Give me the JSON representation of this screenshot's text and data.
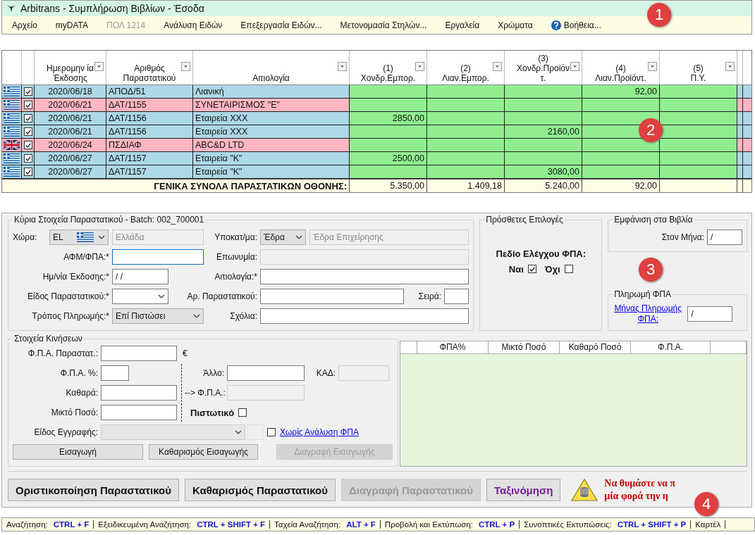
{
  "window": {
    "title": "Arbitrans - Συμπλήρωση Βιβλίων - Έσοδα"
  },
  "menu": [
    {
      "label": "Αρχείο",
      "disabled": false,
      "kind": "text"
    },
    {
      "label": "myDATA",
      "disabled": false,
      "kind": "text"
    },
    {
      "label": "ΠΟΛ 1214",
      "disabled": true,
      "kind": "text"
    },
    {
      "label": "Ανάλυση Ειδών",
      "disabled": false,
      "kind": "text"
    },
    {
      "label": "Επεξεργασία Ειδών...",
      "disabled": false,
      "kind": "text"
    },
    {
      "label": "Μετονομασία Στηλών...",
      "disabled": false,
      "kind": "text"
    },
    {
      "label": "Εργαλεία",
      "disabled": false,
      "kind": "text"
    },
    {
      "label": "Χρώματα",
      "disabled": false,
      "kind": "text"
    },
    {
      "label": "Βοήθεια...",
      "disabled": false,
      "kind": "help"
    }
  ],
  "grid": {
    "columns": [
      {
        "lines": [
          "Ημερομην ία",
          "Έκδοσης"
        ]
      },
      {
        "lines": [
          "Αριθμός",
          "Παραστατικού"
        ]
      },
      {
        "lines": [
          "Αιτιολογία"
        ]
      },
      {
        "lines": [
          "(1)",
          "Χονδρ.Εμπορ."
        ]
      },
      {
        "lines": [
          "(2)",
          "Λιαν.Εμπορ."
        ]
      },
      {
        "lines": [
          "(3)",
          "Χονδρ.Προϊόν",
          "τ."
        ]
      },
      {
        "lines": [
          "(4)",
          "Λιαν.Προϊόντ."
        ]
      },
      {
        "lines": [
          "(5)",
          "Π.Υ."
        ]
      }
    ],
    "rows": [
      {
        "kind": "greek",
        "checked": true,
        "color": "#add8e6",
        "date": "2020/06/18",
        "number": "ΑΠΟΔ/51",
        "reason": "Λιανική",
        "amounts": {
          "col_4": "92,00"
        }
      },
      {
        "kind": "greek",
        "checked": true,
        "color": "#ffb6c1",
        "date": "2020/06/21",
        "number": "ΔΑΤ/1155",
        "reason": "ΣΥΝΕΤΑΙΡΙΣΜΟΣ \"Ε\""
      },
      {
        "kind": "greek",
        "checked": true,
        "color": "#add8e6",
        "date": "2020/06/21",
        "number": "ΔΑΤ/1156",
        "reason": "Εταιρεία ΧΧΧ",
        "amounts": {
          "col_1": "2850,00"
        }
      },
      {
        "kind": "greek",
        "checked": true,
        "color": "#add8e6",
        "date": "2020/06/21",
        "number": "ΔΑΤ/1156",
        "reason": "Εταιρεία ΧΧΧ",
        "amounts": {
          "col_3": "2160,00"
        }
      },
      {
        "kind": "british",
        "checked": true,
        "color": "#ffb6c1",
        "date": "2020/06/24",
        "number": "ΠΣΔΙΑΦ",
        "reason": "ABC&D LTD"
      },
      {
        "kind": "greek",
        "checked": true,
        "color": "#add8e6",
        "date": "2020/06/27",
        "number": "ΔΑΤ/1157",
        "reason": "Εταιρεία \"Κ\"",
        "amounts": {
          "col_1": "2500,00"
        }
      },
      {
        "kind": "greek",
        "checked": true,
        "color": "#add8e6",
        "date": "2020/06/27",
        "number": "ΔΑΤ/1157",
        "reason": "Εταιρεία \"Κ\"",
        "amounts": {
          "col_3": "3080,00"
        }
      }
    ],
    "totals": {
      "label": "ΓΕΝΙΚΑ ΣΥΝΟΛΑ ΠΑΡΑΣΤΑΤΙΚΩΝ ΟΘΟΝΗΣ:",
      "values": {
        "col_1": "5.350,00",
        "col_2": "1.409,18",
        "col_3": "5.240,00",
        "col_4": "92,00"
      }
    }
  },
  "main_details": {
    "title": "Κύρια Στοιχεία Παραστατικού - Batch: 002_700001",
    "country": {
      "label": "Χώρα:",
      "value": "EL",
      "flag": {
        "kind": "greek"
      },
      "kind": "list"
    },
    "country_name": {
      "value": "Ελλάδα",
      "disabled": true
    },
    "branch": {
      "label": "Υποκατ/μα:",
      "value": "Έδρα",
      "kind": "list"
    },
    "branch_name": {
      "value": "Έδρα Επιχείρησης",
      "disabled": true
    },
    "vat_number": {
      "label": "ΑΦΜ/ΦΠΑ:*",
      "focused": true
    },
    "company_name": {
      "label": "Επωνυμία:",
      "disabled": true
    },
    "issue_date": {
      "label": "Ημ/νία Έκδοσης:*",
      "value": "/ /"
    },
    "reason": {
      "label": "Αιτιολογία:*"
    },
    "doc_type": {
      "label": "Είδος Παραστατικού:*",
      "kind": "combo"
    },
    "doc_number": {
      "label": "Αρ. Παραστατικού:"
    },
    "series": {
      "label": "Σειρά:"
    },
    "payment": {
      "label": "Τρόπος Πληρωμής:*",
      "value": "Επί Πιστώσει",
      "kind": "list"
    },
    "comments": {
      "label": "Σχόλια:"
    }
  },
  "extra_options": {
    "title": "Πρόσθετες Επιλογές",
    "vat_check_label": "Πεδίο Ελέγχου ΦΠΑ:",
    "vat_check": [
      {
        "label": "Ναι",
        "checked": true
      },
      {
        "label": "Όχι",
        "checked": false
      }
    ]
  },
  "show_in_books": {
    "title": "Εμφάνιση στα Βιβλία",
    "label": "Στον Μήνα:",
    "value": "/"
  },
  "vat_payment": {
    "title": "Πληρωμή ΦΠΑ",
    "link": "Μήνας Πληρωμής ΦΠΑ:",
    "value": "/"
  },
  "movements": {
    "title": "Στοιχεία Κινήσεων",
    "doc_vat": {
      "label": "Φ.Π.Α. Παραστατ.:",
      "unit": "€"
    },
    "vat_rate": {
      "label": "Φ.Π.Α. %:"
    },
    "net": {
      "label": "Καθαρά:"
    },
    "gross": {
      "label": "Μικτό Ποσό:"
    },
    "other": {
      "label": "Άλλο:"
    },
    "kad": {
      "label": "ΚΑΔ:",
      "disabled": true
    },
    "vat_out": {
      "label": "--> Φ.Π.Α.:",
      "disabled": true
    },
    "credit": {
      "label": "Πιστωτικό",
      "checked": false
    },
    "entry_type": {
      "label": "Είδος Εγγραφής:",
      "disabled": true
    },
    "no_vat_analysis": {
      "label": "Χωρίς Ανάλυση ΦΠΑ",
      "checked": false
    },
    "buttons": [
      {
        "label": "Εισαγωγή",
        "disabled": false
      },
      {
        "label": "Καθαρισμός Εισαγωγής",
        "disabled": false
      },
      {
        "label": "Διαγραφή Εισαγωγής",
        "disabled": true
      }
    ]
  },
  "vat_table": {
    "columns": [
      "ΦΠΑ%",
      "Μικτό Ποσό",
      "Καθαρό Ποσό",
      "Φ.Π.Α."
    ]
  },
  "actions": [
    {
      "label": "Οριστικοποίηση Παραστατικού",
      "disabled": false,
      "kind": "bold"
    },
    {
      "label": "Καθαρισμός Παραστατικού",
      "disabled": false,
      "kind": "bold"
    },
    {
      "label": "Διαγραφή Παραστατικού",
      "disabled": true,
      "kind": "bold"
    },
    {
      "label": "Ταξινόμηση",
      "disabled": false,
      "kind": "accent"
    }
  ],
  "reminder": {
    "lines": [
      "Να θυμάστε να π",
      "μία φορά την η"
    ]
  },
  "shortcuts": [
    {
      "label": "Αναζήτηση:",
      "key": "CTRL + F"
    },
    {
      "label": "Εξειδικευμένη Αναζήτηση:",
      "key": "CTRL + SHIFT + F"
    },
    {
      "label": "Ταχεία Αναζήτηση:",
      "key": "ALT + F"
    },
    {
      "label": "Προβολή και Εκτύπωση:",
      "key": "CTRL + P"
    },
    {
      "label": "Συνοπτικές Εκτυπώσεις:",
      "key": "CTRL + SHIFT + P"
    },
    {
      "label": "Καρτέλ"
    }
  ],
  "badges": [
    "1",
    "2",
    "3",
    "4"
  ]
}
